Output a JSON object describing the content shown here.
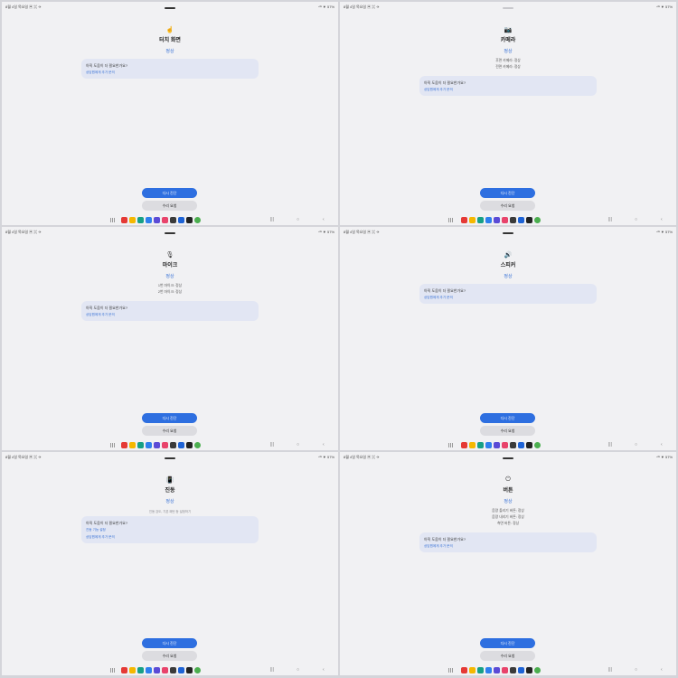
{
  "statusbar": {
    "left": "8월 4일 목요일  ▣ ⌘ ✈",
    "right": "⁴ᴳ ▼ 57%"
  },
  "panels": [
    {
      "icon": "☝",
      "title": "터치 화면",
      "status": "정상",
      "details": [],
      "hint": "",
      "card": {
        "question": "아직 도움이 더 필요한가요?",
        "links": [
          "상담원에게 추가 문의"
        ]
      }
    },
    {
      "icon": "📷",
      "title": "카메라",
      "status": "정상",
      "details": [
        "후면 카메라: 정상",
        "전면 카메라: 정상"
      ],
      "hint": "",
      "card": {
        "question": "아직 도움이 더 필요한가요?",
        "links": [
          "상담원에게 추가 문의"
        ]
      }
    },
    {
      "icon": "🎙",
      "title": "마이크",
      "status": "정상",
      "details": [
        "1번 마이크: 정상",
        "2번 마이크: 정상"
      ],
      "hint": "",
      "card": {
        "question": "아직 도움이 더 필요한가요?",
        "links": [
          "상담원에게 추가 문의"
        ]
      }
    },
    {
      "icon": "🔊",
      "title": "스피커",
      "status": "정상",
      "details": [],
      "hint": "",
      "card": {
        "question": "아직 도움이 더 필요한가요?",
        "links": [
          "상담원에게 추가 문의"
        ]
      }
    },
    {
      "icon": "📳",
      "title": "진동",
      "status": "정상",
      "details": [],
      "hint": "진동 강도, 기본 패턴 등 설정하기",
      "card": {
        "question": "아직 도움이 더 필요한가요?",
        "links": [
          "진동 기능 설정",
          "상담원에게 추가 문의"
        ]
      }
    },
    {
      "icon": "⏻",
      "title": "버튼",
      "status": "정상",
      "details": [
        "음량 올리기 버튼: 정상",
        "음량 내리기 버튼: 정상",
        "측면 버튼: 정상"
      ],
      "hint": "",
      "card": {
        "question": "아직 도움이 더 필요한가요?",
        "links": [
          "상담원에게 추가 문의"
        ]
      }
    }
  ],
  "buttons": {
    "retest": "다시 진단",
    "repair": "수리 요청"
  },
  "dock_icons": [
    {
      "name": "red-app-icon",
      "color": "#e53935"
    },
    {
      "name": "folder-app-icon",
      "color": "#f5b800"
    },
    {
      "name": "teal-app-icon",
      "color": "#16a085"
    },
    {
      "name": "blue-app-icon",
      "color": "#2f80ed"
    },
    {
      "name": "purple-app-icon",
      "color": "#5b4bd6"
    },
    {
      "name": "pink-app-icon",
      "color": "#e8436b"
    },
    {
      "name": "dark-app-icon",
      "color": "#3a3a3a"
    },
    {
      "name": "blue-square-app-icon",
      "color": "#1e63d6"
    },
    {
      "name": "black-circle-app-icon",
      "color": "#222222"
    },
    {
      "name": "chrome-app-icon",
      "color": "#4caf50"
    }
  ],
  "nav": {
    "recent": "|||",
    "home": "○",
    "back": "‹"
  }
}
